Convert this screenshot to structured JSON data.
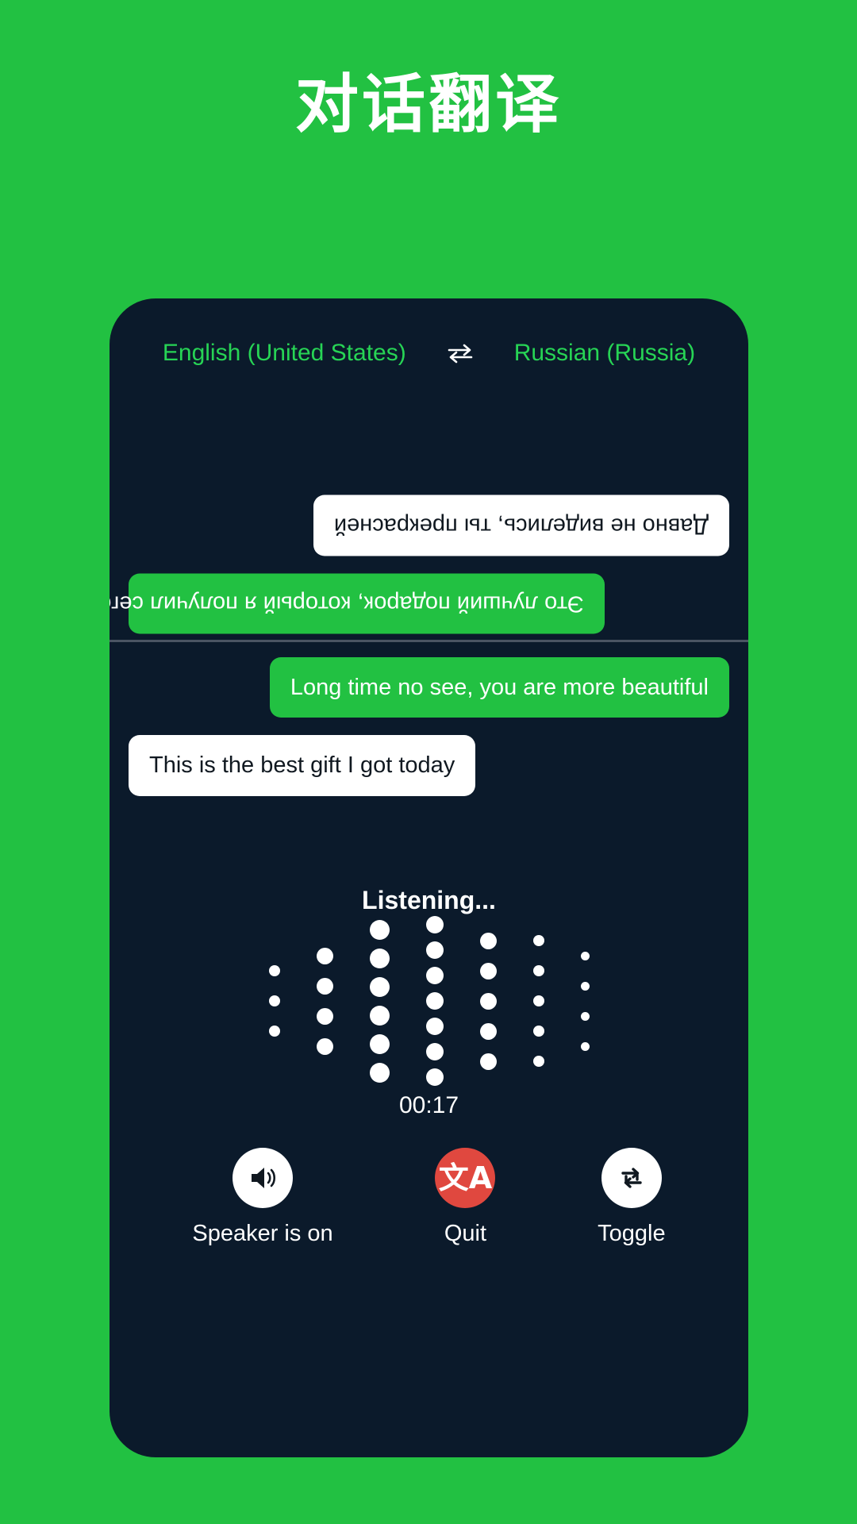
{
  "page": {
    "title": "对话翻译",
    "background_color": "#22c142",
    "card_color": "#0b1a2b"
  },
  "languages": {
    "source": "English (United States)",
    "target": "Russian (Russia)",
    "swap_icon": "swap-horizontal-icon",
    "accent_color": "#27d455"
  },
  "conversation": {
    "top_rotated": [
      {
        "text": "Это лучший подарок, который я получил сегодня",
        "style": "green",
        "align": "left"
      },
      {
        "text": "Давно не виделись, ты прекрасней",
        "style": "white",
        "align": "right"
      }
    ],
    "bottom": [
      {
        "text": "Long time no see, you are more beautiful",
        "style": "green",
        "align": "right"
      },
      {
        "text": "This is the best gift I got today",
        "style": "white",
        "align": "left"
      }
    ]
  },
  "status": {
    "listening_label": "Listening...",
    "timer": "00:17"
  },
  "waveform": {
    "dot_color": "#ffffff",
    "columns": [
      {
        "count": 3,
        "size": 14,
        "gap": 24
      },
      {
        "count": 4,
        "size": 21,
        "gap": 17
      },
      {
        "count": 6,
        "size": 25,
        "gap": 11
      },
      {
        "count": 7,
        "size": 22,
        "gap": 10
      },
      {
        "count": 5,
        "size": 21,
        "gap": 17
      },
      {
        "count": 5,
        "size": 14,
        "gap": 24
      },
      {
        "count": 4,
        "size": 11,
        "gap": 27
      }
    ]
  },
  "controls": [
    {
      "label": "Speaker is on",
      "icon": "speaker-on-icon",
      "circle": "white",
      "glyph": ""
    },
    {
      "label": "Quit",
      "icon": "translate-icon",
      "circle": "red",
      "glyph": "文A"
    },
    {
      "label": "Toggle",
      "icon": "swap-repeat-icon",
      "circle": "white",
      "glyph": ""
    }
  ]
}
